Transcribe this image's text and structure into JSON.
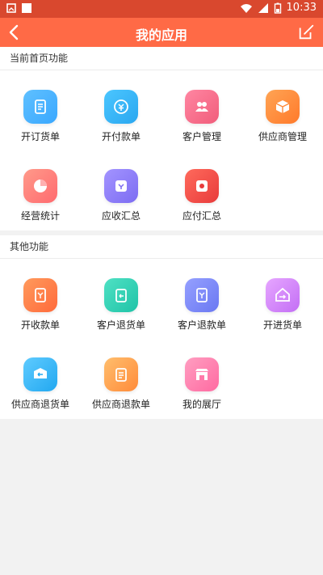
{
  "status_bar": {
    "time": "10:33"
  },
  "header": {
    "title": "我的应用"
  },
  "sections": [
    {
      "title": "当前首页功能",
      "apps": [
        {
          "label": "开订货单",
          "icon": "order-icon",
          "color_a": "#3aa8ff",
          "color_b": "#5fc0ff"
        },
        {
          "label": "开付款单",
          "icon": "payment-icon",
          "color_a": "#2aa7f0",
          "color_b": "#4bc6ff"
        },
        {
          "label": "客户管理",
          "icon": "customers-icon",
          "color_a": "#f15d7b",
          "color_b": "#ff86a2"
        },
        {
          "label": "供应商管理",
          "icon": "supplier-box-icon",
          "color_a": "#ff7a2b",
          "color_b": "#ffa454"
        },
        {
          "label": "经营统计",
          "icon": "pie-chart-icon",
          "color_a": "#ff6a6f",
          "color_b": "#ff9a8a"
        },
        {
          "label": "应收汇总",
          "icon": "receivable-icon",
          "color_a": "#7c6cf2",
          "color_b": "#a394ff"
        },
        {
          "label": "应付汇总",
          "icon": "payable-icon",
          "color_a": "#e83b3b",
          "color_b": "#ff6a5c"
        }
      ]
    },
    {
      "title": "其他功能",
      "apps": [
        {
          "label": "开收款单",
          "icon": "receipt-icon",
          "color_a": "#ff6a3b",
          "color_b": "#ff9a5c"
        },
        {
          "label": "客户退货单",
          "icon": "customer-return-goods-icon",
          "color_a": "#1fc3a7",
          "color_b": "#4fe1c4"
        },
        {
          "label": "客户退款单",
          "icon": "customer-refund-icon",
          "color_a": "#6a78f2",
          "color_b": "#95a0ff"
        },
        {
          "label": "开进货单",
          "icon": "purchase-in-icon",
          "color_a": "#c36ef5",
          "color_b": "#e6a6ff"
        },
        {
          "label": "供应商退货单",
          "icon": "supplier-return-goods-icon",
          "color_a": "#22a8f0",
          "color_b": "#5fcbff"
        },
        {
          "label": "供应商退款单",
          "icon": "supplier-refund-icon",
          "color_a": "#ff8b3a",
          "color_b": "#ffbe6d"
        },
        {
          "label": "我的展厅",
          "icon": "showroom-icon",
          "color_a": "#ff6aa1",
          "color_b": "#ff9ec1"
        }
      ]
    }
  ]
}
